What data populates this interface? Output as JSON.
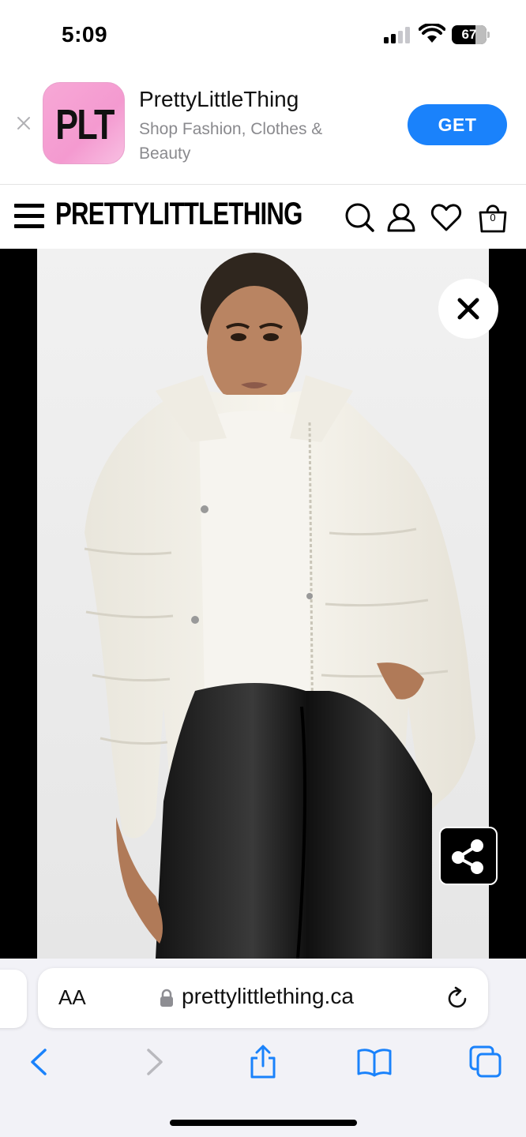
{
  "status_bar": {
    "time": "5:09",
    "battery_level": "67"
  },
  "app_banner": {
    "icon_text": "PLT",
    "app_name": "PrettyLittleThing",
    "app_subtitle": "Shop Fashion, Clothes & Beauty",
    "get_label": "GET",
    "get_color": "#1a82fb"
  },
  "site_header": {
    "logo_text": "PRETTYLITTLETHING",
    "bag_count": "0",
    "icons": [
      "menu-icon",
      "search-icon",
      "account-icon",
      "wishlist-heart-icon",
      "shopping-bag-icon"
    ]
  },
  "product_view": {
    "close_icon": "close-icon",
    "share_icon": "share-icon"
  },
  "safari": {
    "text_size_label": "AA",
    "url": "prettylittlething.ca",
    "toolbar_icons": [
      "back-icon",
      "forward-icon",
      "share-icon",
      "bookmarks-icon",
      "tabs-icon"
    ],
    "accent_color": "#1a82fb"
  }
}
